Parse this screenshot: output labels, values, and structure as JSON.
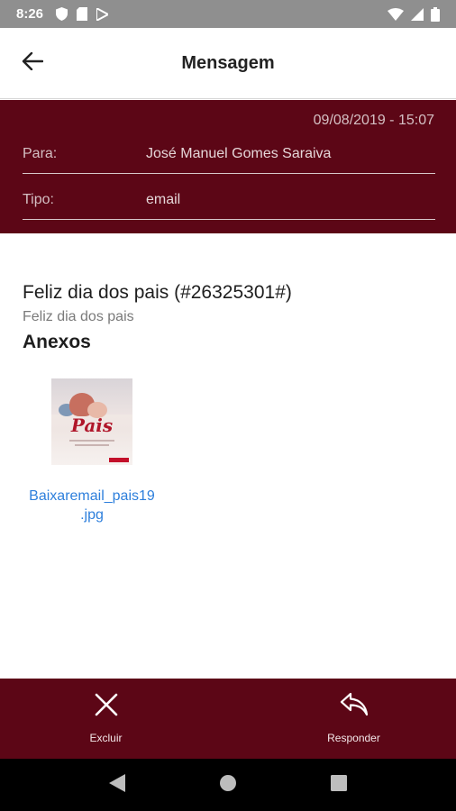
{
  "status_bar": {
    "time": "8:26",
    "left_icons": [
      "shield-icon",
      "sim-card-icon",
      "play-store-icon"
    ],
    "right_icons": [
      "wifi-icon",
      "signal-icon",
      "battery-icon"
    ],
    "color": "#8f8f8f"
  },
  "app_bar": {
    "title": "Mensagem",
    "back_icon": "arrow-left-icon"
  },
  "header": {
    "date": "09/08/2019 - 15:07",
    "to_label": "Para:",
    "to_value": "José Manuel Gomes Saraiva",
    "type_label": "Tipo:",
    "type_value": "email",
    "background": "#5c0616"
  },
  "message": {
    "subject": "Feliz dia dos pais (#26325301#)",
    "body": "Feliz dia dos pais",
    "attachments_title": "Anexos"
  },
  "attachments": [
    {
      "name_line1": "Baixaremail_pais19",
      "name_line2": ".jpg",
      "thumb_text": "Pais"
    }
  ],
  "actions": {
    "delete_label": "Excluir",
    "delete_icon": "close-icon",
    "reply_label": "Responder",
    "reply_icon": "reply-icon"
  },
  "nav_bar": {
    "buttons": [
      "back-triangle-icon",
      "home-circle-icon",
      "recents-square-icon"
    ]
  },
  "colors": {
    "accent": "#5c0616",
    "link": "#2d7fdc"
  }
}
